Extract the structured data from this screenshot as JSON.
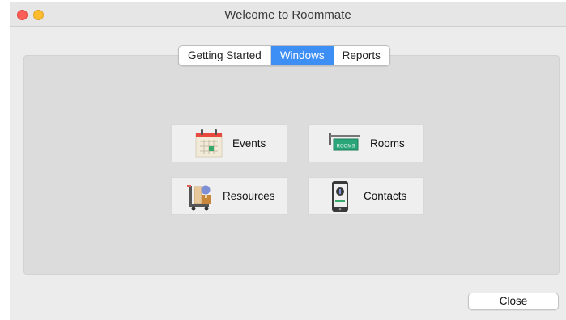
{
  "window": {
    "title": "Welcome to Roommate"
  },
  "tabs": [
    {
      "label": "Getting Started",
      "active": false
    },
    {
      "label": "Windows",
      "active": true
    },
    {
      "label": "Reports",
      "active": false
    }
  ],
  "tiles": {
    "events": {
      "label": "Events",
      "icon": "calendar-icon"
    },
    "rooms": {
      "label": "Rooms",
      "icon": "room-sign-icon",
      "sign_text": "ROOMS"
    },
    "resources": {
      "label": "Resources",
      "icon": "cart-icon"
    },
    "contacts": {
      "label": "Contacts",
      "icon": "phone-contact-icon"
    }
  },
  "footer": {
    "close_label": "Close"
  },
  "colors": {
    "accent": "#3d8ff5",
    "close_dot": "#fc5f57",
    "minimize_dot": "#fdbc2e"
  }
}
